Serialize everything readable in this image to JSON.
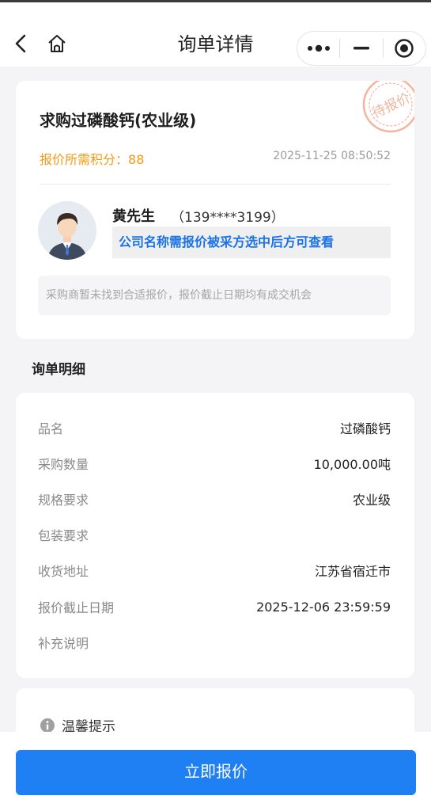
{
  "header": {
    "title": "询单详情",
    "back_icon": "chevron-left-icon",
    "home_icon": "home-icon"
  },
  "inquiry": {
    "product_title": "求购过磷酸钙(农业级)",
    "points_label": "报价所需积分：",
    "points_value": "88",
    "datetime": "2025-11-25 08:50:52",
    "stamp_text": "待报价",
    "contact_name": "黄先生",
    "contact_phone": "（139****3199）",
    "company_note": "公司名称需报价被采方选中后方可查看",
    "hint": "采购商暂未找到合适报价，报价截止日期均有成交机会"
  },
  "details": {
    "section_title": "询单明细",
    "rows": [
      {
        "label": "品名",
        "value": "过磷酸钙"
      },
      {
        "label": "采购数量",
        "value": "10,000.00吨"
      },
      {
        "label": "规格要求",
        "value": "农业级"
      },
      {
        "label": "包装要求",
        "value": ""
      },
      {
        "label": "收货地址",
        "value": "江苏省宿迁市"
      },
      {
        "label": "报价截止日期",
        "value": "2025-12-06 23:59:59"
      },
      {
        "label": "补充说明",
        "value": ""
      }
    ]
  },
  "tips": {
    "title": "温馨提示"
  },
  "actions": {
    "quote_label": "立即报价"
  },
  "colors": {
    "primary": "#1e80f3",
    "orange": "#f59a16",
    "stamp": "#f3b49d"
  }
}
